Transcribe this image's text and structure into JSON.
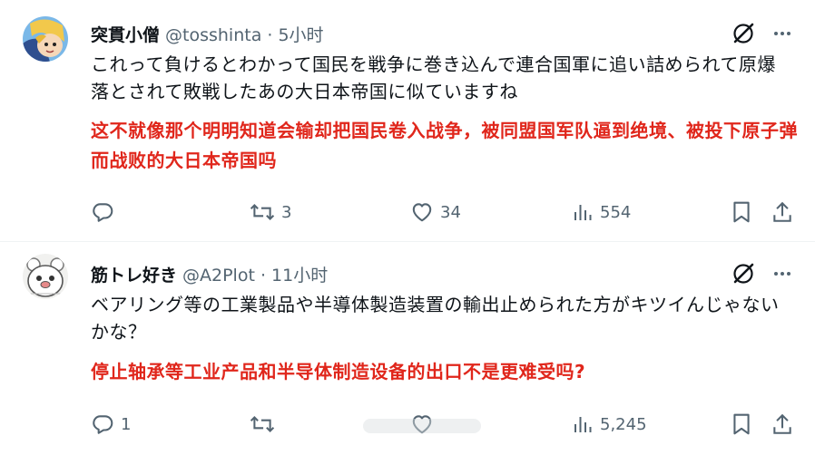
{
  "tweets": [
    {
      "author_name": "突貫小僧",
      "handle": "@tosshinta",
      "time": "5小时",
      "text_jp": "これって負けるとわかって国民を戦争に巻き込んで連合国軍に追い詰められて原爆落とされて敗戦したあの大日本帝国に似ていますね",
      "text_cn": "这不就像那个明明知道会输却把国民卷入战争，被同盟国军队逼到绝境、被投下原子弹而战败的大日本帝国吗",
      "reply_count": "",
      "retweet_count": "3",
      "like_count": "34",
      "view_count": "554"
    },
    {
      "author_name": "筋トレ好き",
      "handle": "@A2Plot",
      "time": "11小时",
      "text_jp": "ベアリング等の工業製品や半導体製造装置の輸出止められた方がキツイんじゃないかな？",
      "text_cn": "停止轴承等工业产品和半导体制造设备的出口不是更难受吗?",
      "reply_count": "1",
      "retweet_count": "",
      "like_count": "",
      "view_count": "5,245"
    }
  ],
  "icons": {
    "reply": "reply-icon",
    "retweet": "retweet-icon",
    "like": "heart-icon",
    "views": "views-icon",
    "bookmark": "bookmark-icon",
    "share": "share-icon",
    "grok": "grok-icon",
    "more": "more-icon"
  },
  "colors": {
    "text": "#0f1419",
    "secondary": "#536471",
    "translation": "#e0261b",
    "divider": "#eff3f4"
  }
}
